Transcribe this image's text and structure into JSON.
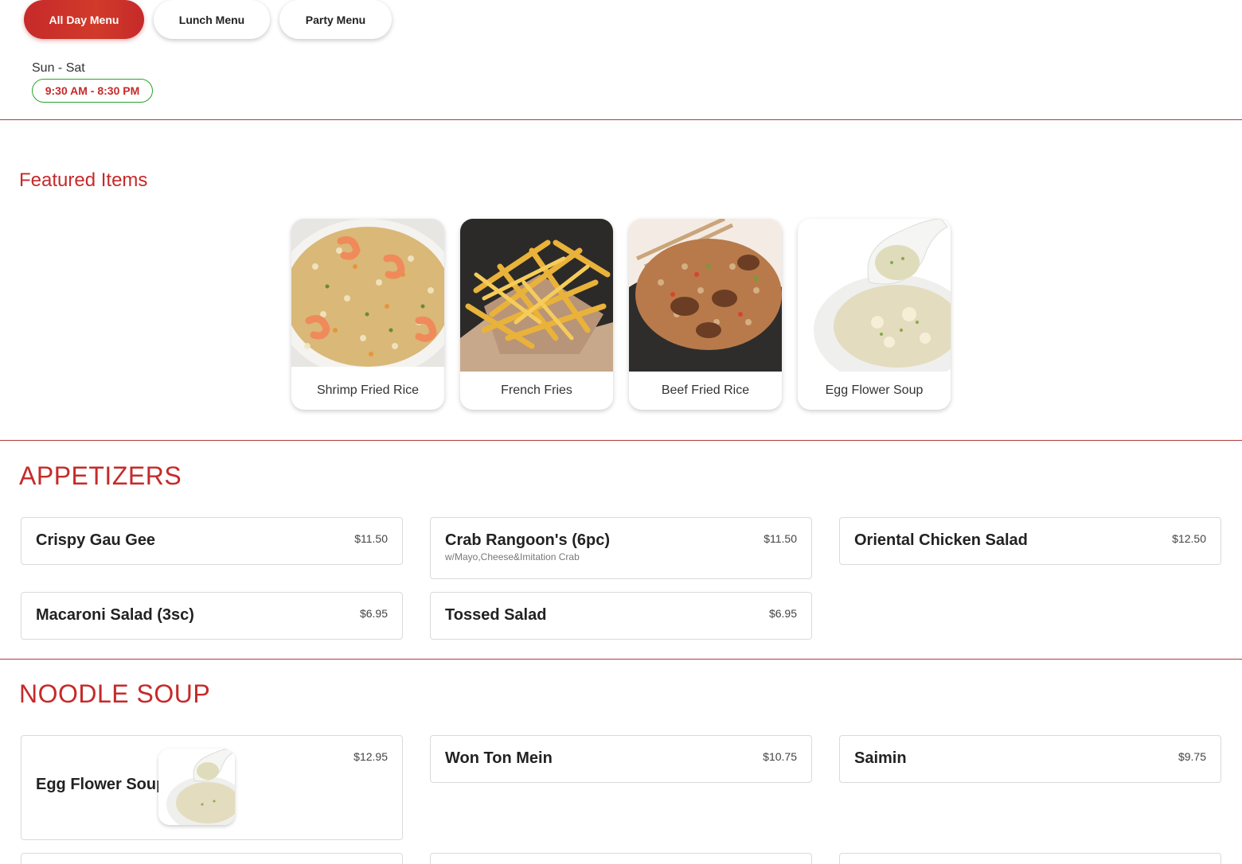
{
  "menu_tabs": [
    "All Day Menu",
    "Lunch Menu",
    "Party Menu"
  ],
  "active_tab": "All Day Menu",
  "hours": {
    "days": "Sun - Sat",
    "time": "9:30 AM - 8:30 PM"
  },
  "featured": {
    "title": "Featured Items",
    "items": [
      "Shrimp Fried Rice",
      "French Fries",
      "Beef Fried Rice",
      "Egg Flower Soup"
    ]
  },
  "appetizers": {
    "title": "APPETIZERS",
    "items": [
      {
        "name": "Crispy Gau Gee",
        "price": "$11.50"
      },
      {
        "name": "Crab Rangoon's (6pc)",
        "price": "$11.50",
        "desc": "w/Mayo,Cheese&Imitation Crab"
      },
      {
        "name": "Oriental Chicken Salad",
        "price": "$12.50"
      },
      {
        "name": "Macaroni Salad (3sc)",
        "price": "$6.95"
      },
      {
        "name": "Tossed Salad",
        "price": "$6.95"
      }
    ]
  },
  "noodle_soup": {
    "title": "NOODLE SOUP",
    "items": [
      {
        "name": "Egg Flower Soup",
        "price": "$12.95"
      },
      {
        "name": "Won Ton Mein",
        "price": "$10.75"
      },
      {
        "name": "Saimin",
        "price": "$9.75"
      }
    ]
  },
  "colors": {
    "accent": "#c62a2a",
    "hours_border": "#2aa52a",
    "divider": "#b03a3a"
  }
}
